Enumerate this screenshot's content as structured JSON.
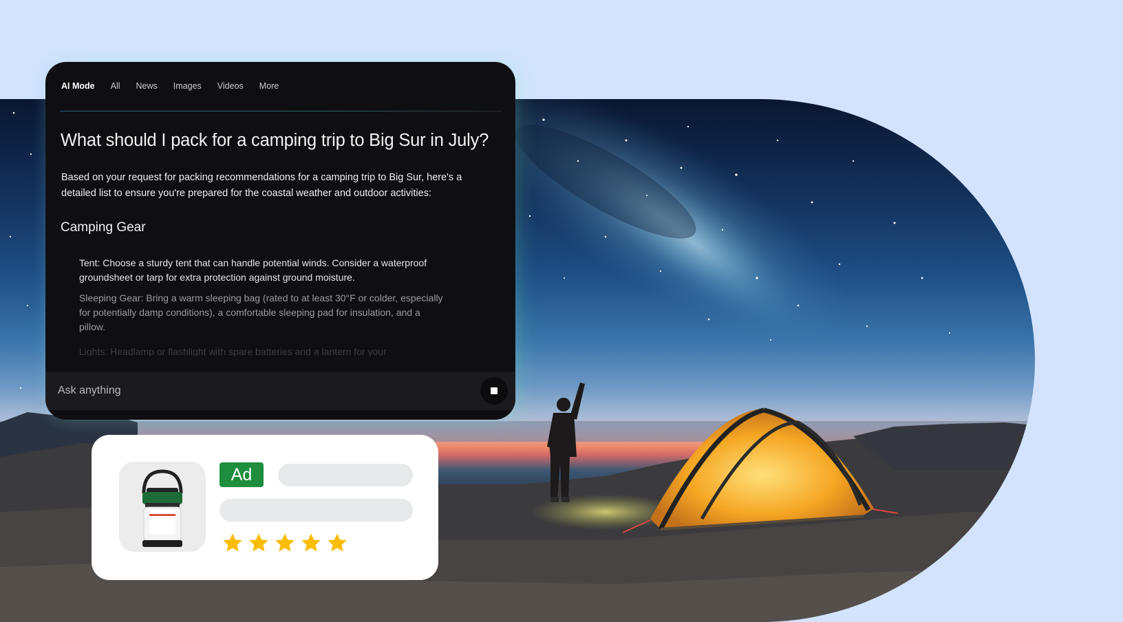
{
  "tabs": [
    {
      "label": "AI Mode",
      "active": true
    },
    {
      "label": "All",
      "active": false
    },
    {
      "label": "News",
      "active": false
    },
    {
      "label": "Images",
      "active": false
    },
    {
      "label": "Videos",
      "active": false
    },
    {
      "label": "More",
      "active": false
    }
  ],
  "question": "What should I pack for a camping trip to Big Sur in July?",
  "intro": "Based on your request for packing recommendations for a camping trip to Big Sur, here's a detailed list to ensure you're prepared for the coastal weather and outdoor activities:",
  "section_title": "Camping Gear",
  "items": [
    "Tent: Choose a sturdy tent that can handle potential winds. Consider a waterproof groundsheet or tarp for extra protection against ground moisture.",
    "Sleeping Gear: Bring a warm sleeping bag (rated to at least 30°F or colder, especially for potentially damp conditions), a comfortable sleeping pad for insulation, and a pillow.",
    "Lights: Headlamp or flashlight with spare batteries and a lantern for your"
  ],
  "ask_placeholder": "Ask anything",
  "ad": {
    "badge": "Ad",
    "rating": 5,
    "max_rating": 5,
    "star_color": "#fbbc04",
    "badge_color": "#1e8e3e"
  },
  "icons": {
    "stop": "stop-icon",
    "product": "lantern-icon",
    "star": "star-icon"
  }
}
